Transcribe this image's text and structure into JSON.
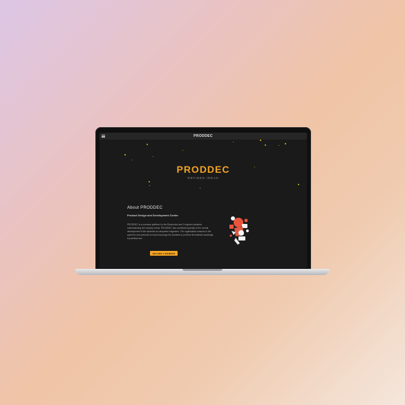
{
  "nav": {
    "brand": "PRODDEC",
    "menu_icon": "hamburger-menu-icon"
  },
  "hero": {
    "title": "PRODDEC",
    "subtitle": "REFINED IDEAS"
  },
  "about": {
    "heading": "About PRODDEC",
    "subheading": "Product Design and Development Center",
    "body": "PRODDEC is a common platform for the Electronics and Computer students, understanding the industry needs. PRODDEC has contributed greatly to the overall development of the students as competent engineers. The organisation ensures in the quest for new avenues to help encourage the students to put their theoretical knowledge to practical use.",
    "button": "BECOME A MEMBER"
  },
  "colors": {
    "accent": "#f0a326",
    "screen_bg": "#1a1a1a",
    "nav_bg": "#262626"
  },
  "illustration_icon": "creative-ideas-illustration-icon"
}
